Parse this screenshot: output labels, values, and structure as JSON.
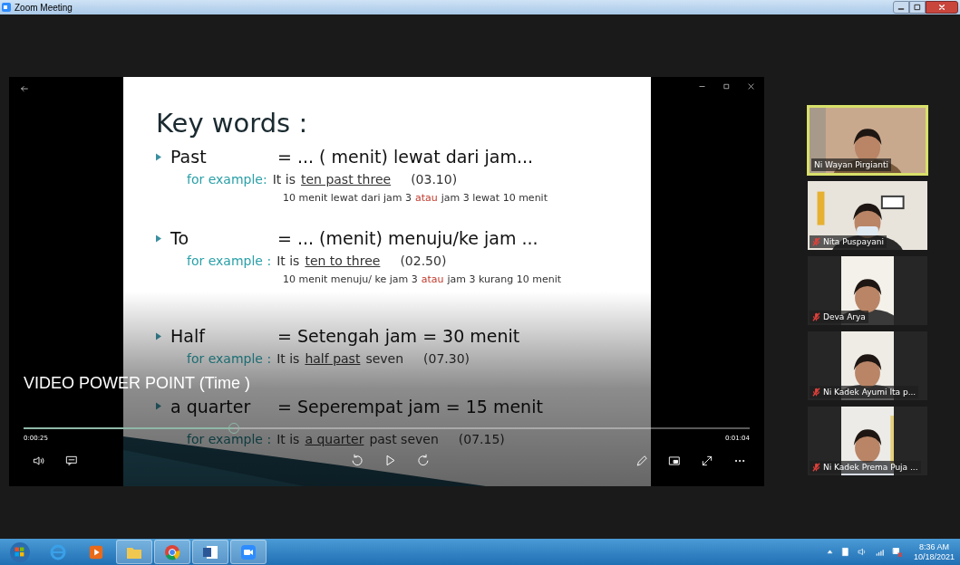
{
  "window": {
    "title": "Zoom Meeting"
  },
  "slide": {
    "heading": "Key words :",
    "items": [
      {
        "term": "Past",
        "definition": "= ... ( menit) lewat dari jam...",
        "example": {
          "label": "for example:",
          "prefix": "It is",
          "underlined": "ten past three",
          "time": "(03.10)"
        },
        "note": {
          "before": "10 menit lewat dari jam 3",
          "conj": "atau",
          "after": "jam 3 lewat 10  menit"
        }
      },
      {
        "term": "To",
        "definition": "= ... (menit) menuju/ke jam ...",
        "example": {
          "label": "for example :",
          "prefix": "It is",
          "underlined": "ten to three",
          "time": "(02.50)"
        },
        "note": {
          "before": "10 menit menuju/ ke jam 3",
          "conj": "atau",
          "after": "jam 3 kurang 10 menit"
        }
      },
      {
        "term": "Half",
        "definition": "= Setengah jam = 30 menit",
        "example": {
          "label": "for example :",
          "prefix": "It is",
          "underlined": "half past",
          "suffix": "seven",
          "time": "(07.30)"
        }
      },
      {
        "term": "a quarter",
        "definition": "= Seperempat jam = 15 menit",
        "example": {
          "label": "for example :",
          "prefix": "It is",
          "underlined": "a quarter",
          "suffix": "past seven",
          "time": "(07.15)"
        }
      }
    ]
  },
  "player": {
    "title": "VIDEO POWER POINT (Time )",
    "level": 0.29,
    "elapsed": "0:00:25",
    "duration": "0:01:04"
  },
  "participants": [
    {
      "name": "Ni Wayan Pirgianti",
      "muted": false,
      "selected": true
    },
    {
      "name": "Nita Puspayani",
      "muted": true,
      "selected": false
    },
    {
      "name": "Deva Arya",
      "muted": true,
      "selected": false
    },
    {
      "name": "Ni Kadek Ayumi Ita p...",
      "muted": true,
      "selected": false
    },
    {
      "name": "Ni Kadek Prema Puja ...",
      "muted": true,
      "selected": false
    }
  ],
  "taskbar": {
    "time": "8:36 AM",
    "date": "10/18/2021"
  }
}
